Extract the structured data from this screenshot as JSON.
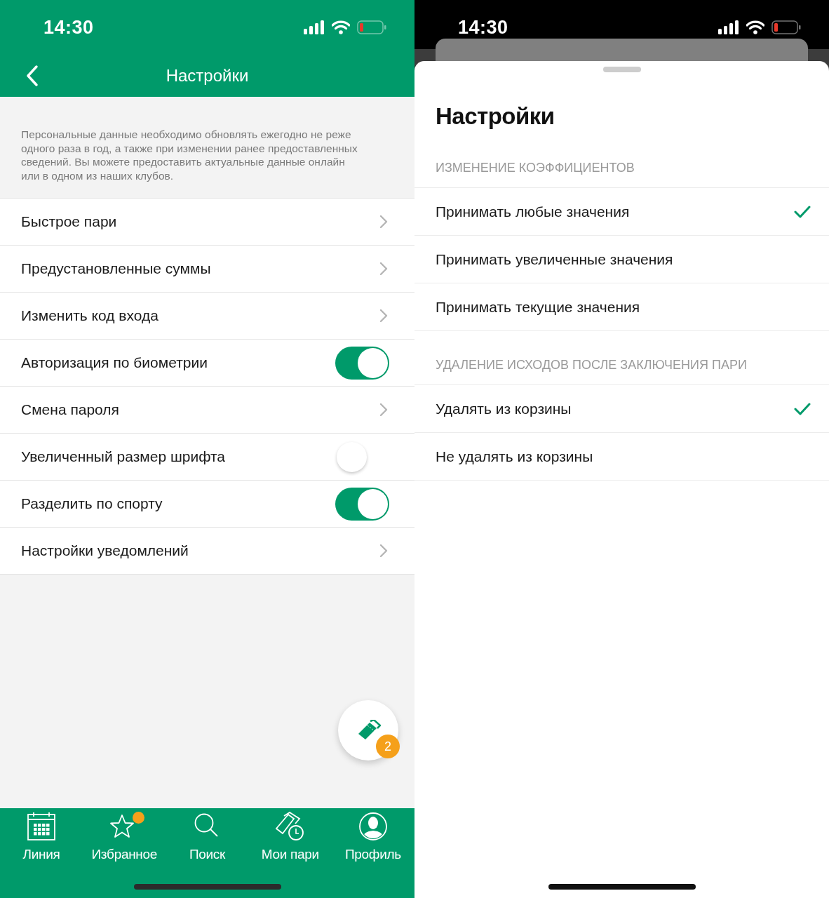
{
  "left": {
    "status_bar": {
      "time": "14:30"
    },
    "header": {
      "title": "Настройки"
    },
    "notice": "Персональные данные необходимо обновлять ежегодно не реже одного раза в год, а также при изменении ранее предоставленных сведений. Вы можете предоставить актуальные данные онлайн или в одном из наших клубов.",
    "rows": [
      {
        "kind": "link",
        "label": "Быстрое пари"
      },
      {
        "kind": "link",
        "label": "Предустановленные суммы"
      },
      {
        "kind": "link",
        "label": "Изменить код входа"
      },
      {
        "kind": "toggle",
        "label": "Авторизация по биометрии",
        "on": true
      },
      {
        "kind": "link",
        "label": "Смена пароля"
      },
      {
        "kind": "toggle",
        "label": "Увеличенный размер шрифта",
        "on": false
      },
      {
        "kind": "toggle",
        "label": "Разделить по спорту",
        "on": true
      },
      {
        "kind": "link",
        "label": "Настройки уведомлений"
      }
    ],
    "bet_slip_button": {
      "count": "2"
    },
    "tab_bar": [
      {
        "label": "Линия",
        "dot": false
      },
      {
        "label": "Избранное",
        "dot": true
      },
      {
        "label": "Поиск",
        "dot": false
      },
      {
        "label": "Мои пари",
        "dot": false
      },
      {
        "label": "Профиль",
        "dot": false
      }
    ]
  },
  "right": {
    "status_bar": {
      "time": "14:30"
    },
    "title": "Настройки",
    "sections": [
      {
        "heading": "ИЗМЕНЕНИЕ КОЭФФИЦИЕНТОВ",
        "options": [
          {
            "label": "Принимать любые значения",
            "selected": true
          },
          {
            "label": "Принимать увеличенные значения",
            "selected": false
          },
          {
            "label": "Принимать текущие значения",
            "selected": false
          }
        ]
      },
      {
        "heading": "УДАЛЕНИЕ ИСХОДОВ ПОСЛЕ ЗАКЛЮЧЕНИЯ ПАРИ",
        "options": [
          {
            "label": "Удалять из корзины",
            "selected": true
          },
          {
            "label": "Не удалять из корзины",
            "selected": false
          }
        ]
      }
    ]
  }
}
